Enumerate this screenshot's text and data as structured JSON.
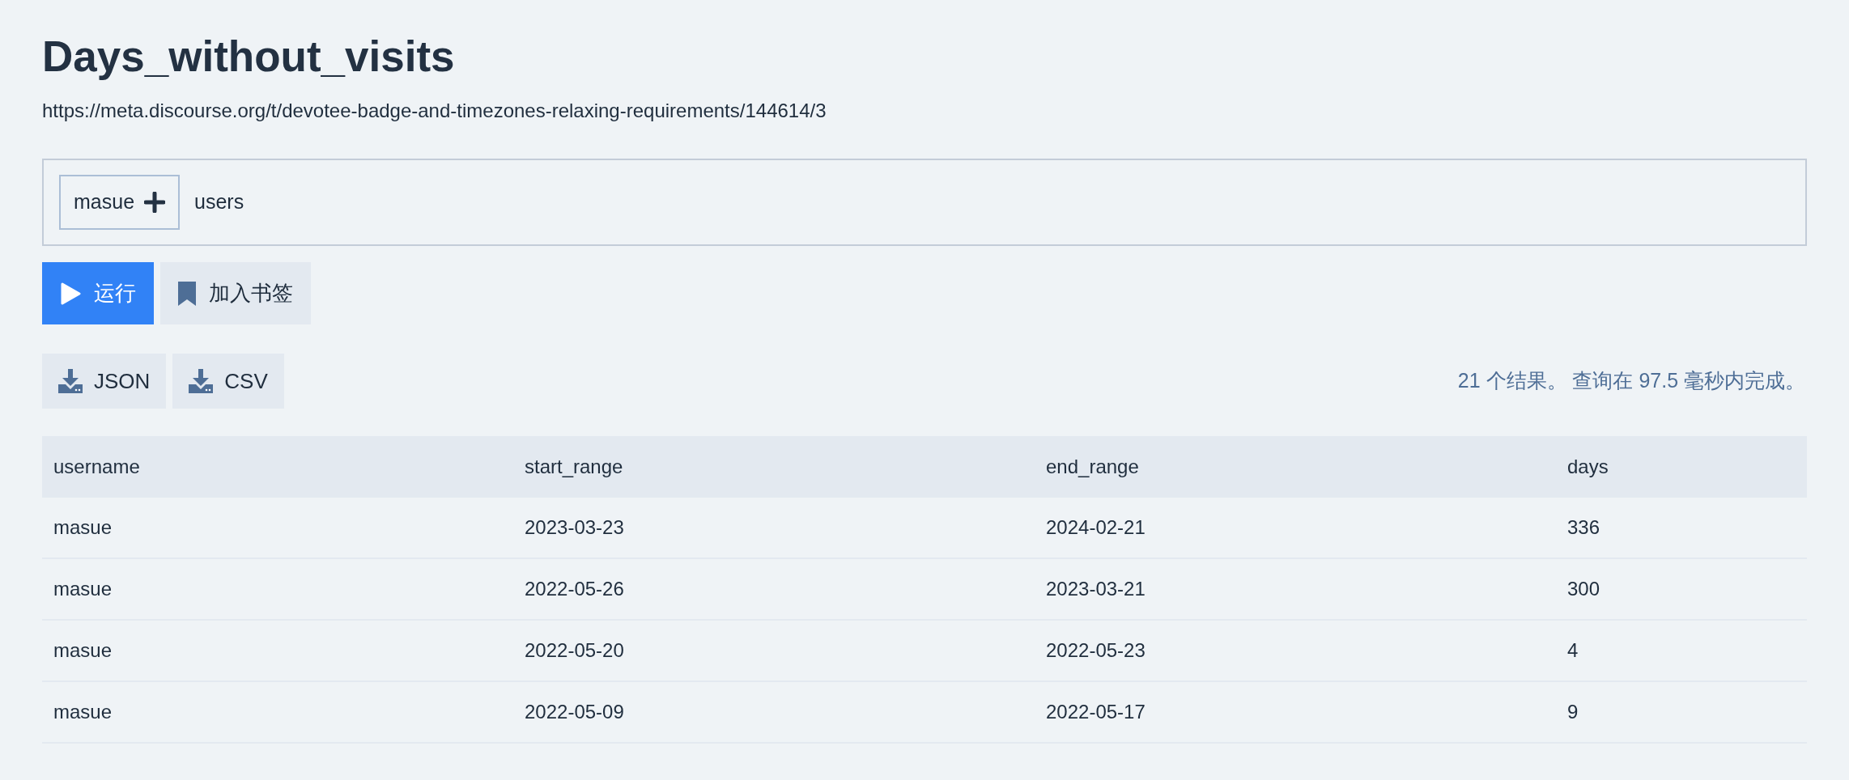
{
  "title": "Days_without_visits",
  "url": "https://meta.discourse.org/t/devotee-badge-and-timezones-relaxing-requirements/144614/3",
  "param": {
    "chip": "masue",
    "value": "users"
  },
  "actions": [
    {
      "kind": "run",
      "label": "运行"
    },
    {
      "kind": "bookmark",
      "label": "加入书签"
    }
  ],
  "downloads": [
    "JSON",
    "CSV"
  ],
  "result_info": "21 个结果。 查询在 97.5 毫秒内完成。",
  "table": {
    "columns": [
      "username",
      "start_range",
      "end_range",
      "days"
    ],
    "rows": [
      [
        "masue",
        "2023-03-23",
        "2024-02-21",
        "336"
      ],
      [
        "masue",
        "2022-05-26",
        "2023-03-21",
        "300"
      ],
      [
        "masue",
        "2022-05-20",
        "2022-05-23",
        "4"
      ],
      [
        "masue",
        "2022-05-09",
        "2022-05-17",
        "9"
      ]
    ]
  }
}
